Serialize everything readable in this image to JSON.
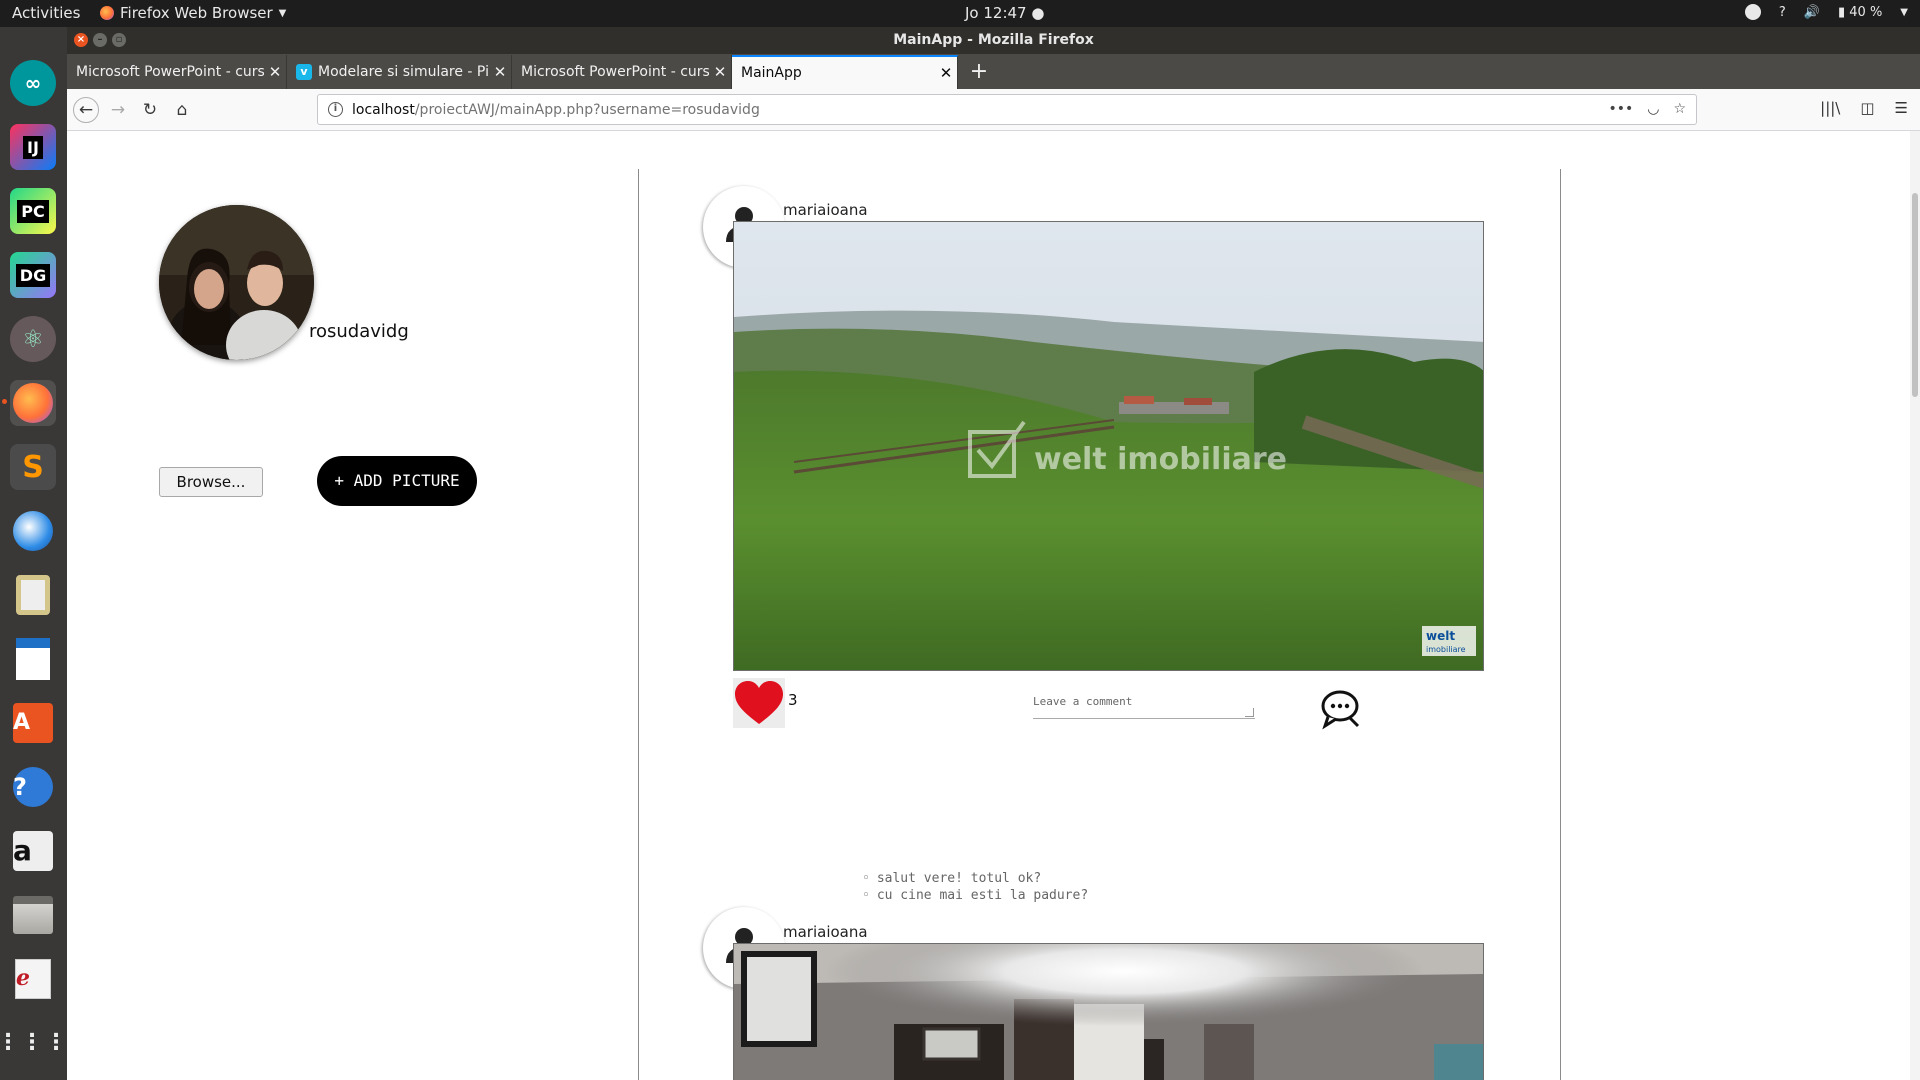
{
  "topbar": {
    "activities": "Activities",
    "app_menu": "Firefox Web Browser",
    "clock": "Jo 12:47",
    "battery": "40 %"
  },
  "window": {
    "title": "MainApp - Mozilla Firefox"
  },
  "tabs": [
    {
      "label": "Microsoft PowerPoint - curs"
    },
    {
      "label": "Modelare si simulare - Pi"
    },
    {
      "label": "Microsoft PowerPoint - curs"
    },
    {
      "label": "MainApp"
    }
  ],
  "url": {
    "host": "localhost",
    "path": "/proiectAWJ/mainApp.php?username=rosudavidg"
  },
  "profile": {
    "username": "rosudavidg"
  },
  "upload": {
    "browse_label": "Browse...",
    "add_label": "+ ADD PICTURE"
  },
  "posts": [
    {
      "user": "mariaioana",
      "likes": "3",
      "comment_placeholder": "Leave a comment",
      "comments": [
        "salut vere! totul ok?",
        "cu cine mai esti la padure?"
      ],
      "watermark": "welt imobiliare",
      "badge_line1": "welt",
      "badge_line2": "imobiliare"
    },
    {
      "user": "mariaioana"
    }
  ],
  "colors": {
    "accent": "#e95420",
    "heart": "#e0101e",
    "tab_highlight": "#0a84ff"
  }
}
